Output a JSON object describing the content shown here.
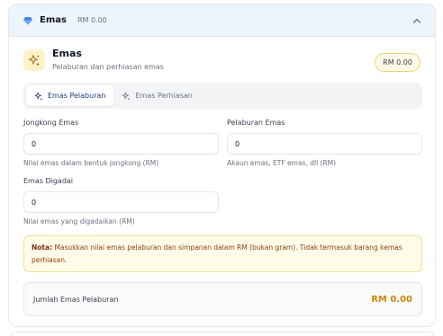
{
  "header": {
    "title": "Emas",
    "amount": "RM 0.00",
    "gem_icon": "gem-icon",
    "toggle_icon": "chevron-up-icon"
  },
  "section": {
    "title": "Emas",
    "subtitle": "Pelaburan dan perhiasan emas",
    "total_pill": "RM 0.00",
    "icon": "sparkles-icon"
  },
  "tabs": [
    {
      "label": "Emas Pelaburan",
      "active": true
    },
    {
      "label": "Emas Perhiasan",
      "active": false
    }
  ],
  "fields": {
    "jongkong": {
      "label": "Jongkong Emas",
      "value": "0",
      "help": "Nilai emas dalam bentuk jongkong (RM)"
    },
    "pelaburan": {
      "label": "Pelaburan Emas",
      "value": "0",
      "help": "Akaun emas, ETF emas, dll (RM)"
    },
    "digadai": {
      "label": "Emas Digadai",
      "value": "0",
      "help": "Nilai emas yang digadaikan (RM)"
    }
  },
  "note": {
    "prefix": "Nota:",
    "text": " Masukkan nilai emas pelaburan dan simpanan dalam RM (bukan gram). Tidak termasuk barang kemas perhiasan."
  },
  "total": {
    "label": "Jumlah Emas Pelaburan",
    "value": "RM 0.00"
  },
  "colors": {
    "accent": "#1e3a8a",
    "gold": "#ca8a04",
    "header_bg": "#eef4fb",
    "note_bg": "#fefbe8"
  }
}
